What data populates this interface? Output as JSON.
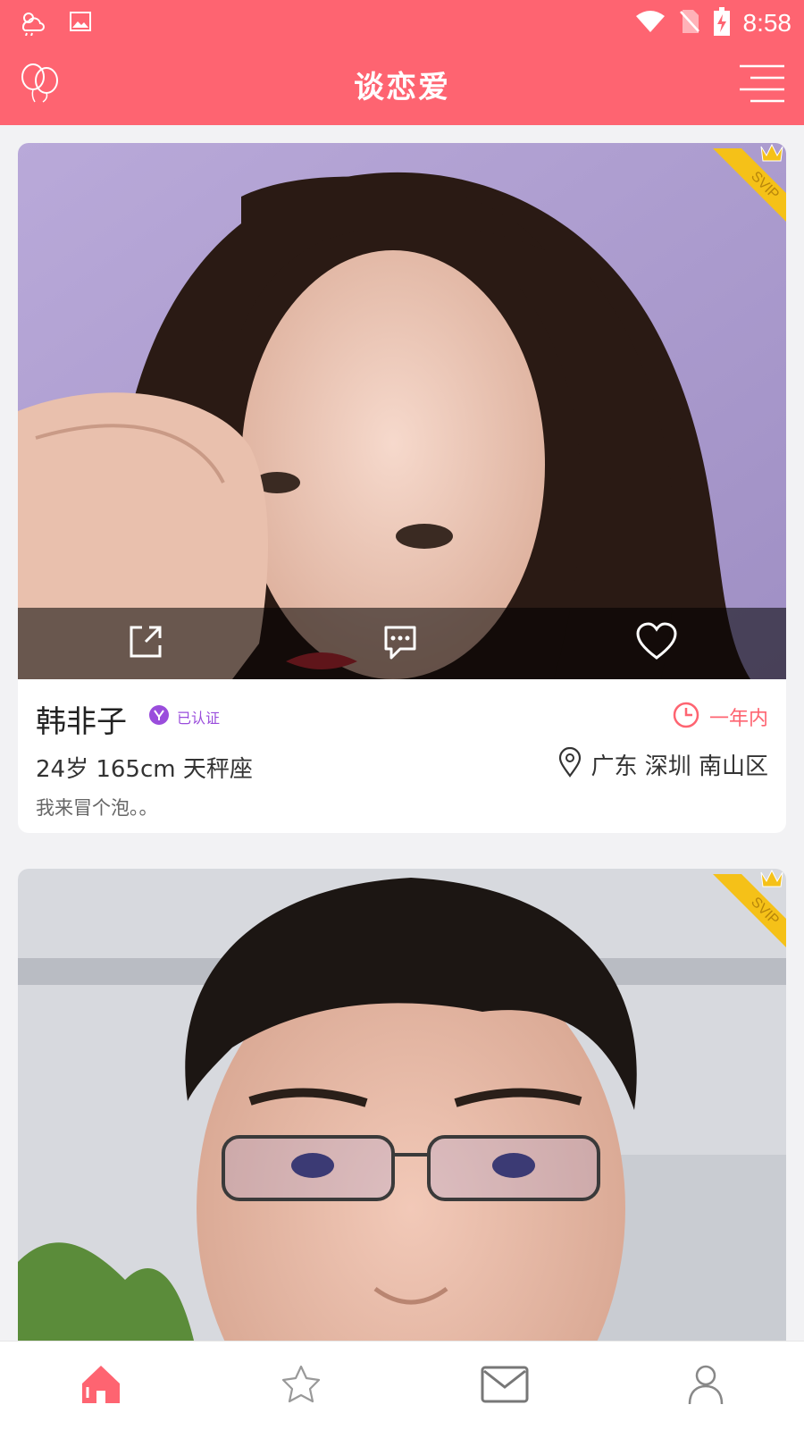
{
  "status_bar": {
    "time": "8:58"
  },
  "app_bar": {
    "title": "谈恋爱"
  },
  "cards": [
    {
      "badge": "SVIP",
      "name": "韩非子",
      "verified_label": "已认证",
      "last_active": "一年内",
      "stats": "24岁 165cm 天秤座",
      "location": "广东 深圳 南山区",
      "bio": "我来冒个泡。。"
    },
    {
      "badge": "SVIP"
    }
  ],
  "tabs": [
    {
      "name": "home",
      "icon": "home-icon",
      "active": true
    },
    {
      "name": "favorites",
      "icon": "star-icon",
      "active": false
    },
    {
      "name": "messages",
      "icon": "mail-icon",
      "active": false
    },
    {
      "name": "profile",
      "icon": "user-icon",
      "active": false
    }
  ],
  "colors": {
    "accent": "#fe6471",
    "verified": "#9a4ddc",
    "svip": "#f5c118"
  }
}
